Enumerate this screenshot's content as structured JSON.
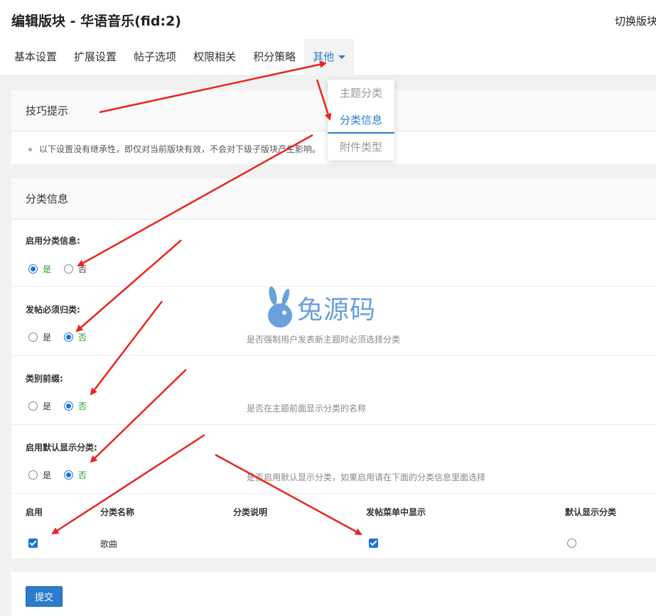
{
  "header": {
    "title": "编辑版块 - 华语音乐(fid:2)",
    "switch_label": "切换版块"
  },
  "tabs": [
    {
      "label": "基本设置"
    },
    {
      "label": "扩展设置"
    },
    {
      "label": "帖子选项"
    },
    {
      "label": "权限相关"
    },
    {
      "label": "积分策略"
    },
    {
      "label": "其他"
    }
  ],
  "dropdown": {
    "items": [
      {
        "label": "主题分类"
      },
      {
        "label": "分类信息"
      },
      {
        "label": "附件类型"
      }
    ]
  },
  "tips": {
    "title": "技巧提示",
    "text": "以下设置没有继承性，即仅对当前版块有效，不会对下级子版块产生影响。"
  },
  "section": {
    "title": "分类信息",
    "fields": [
      {
        "label": "启用分类信息:",
        "yes": "是",
        "no": "否",
        "selected": "yes",
        "desc": ""
      },
      {
        "label": "发帖必须归类:",
        "yes": "是",
        "no": "否",
        "selected": "no",
        "desc": "是否强制用户发表新主题时必须选择分类"
      },
      {
        "label": "类别前缀:",
        "yes": "是",
        "no": "否",
        "selected": "no",
        "desc": "是否在主题前面显示分类的名称"
      },
      {
        "label": "启用默认显示分类:",
        "yes": "是",
        "no": "否",
        "selected": "no",
        "desc": "是否启用默认显示分类，如果启用请在下面的分类信息里面选择"
      }
    ],
    "table": {
      "headers": [
        "启用",
        "分类名称",
        "分类说明",
        "发帖菜单中显示",
        "默认显示分类"
      ],
      "rows": [
        {
          "enabled": true,
          "name": "歌曲",
          "desc": "",
          "in_menu": true,
          "default": false
        }
      ]
    }
  },
  "submit_label": "提交",
  "watermark": "兔源码",
  "colors": {
    "accent": "#2b7dcc",
    "arrow": "#e8261c",
    "selected_text": "#2a9a2a"
  }
}
